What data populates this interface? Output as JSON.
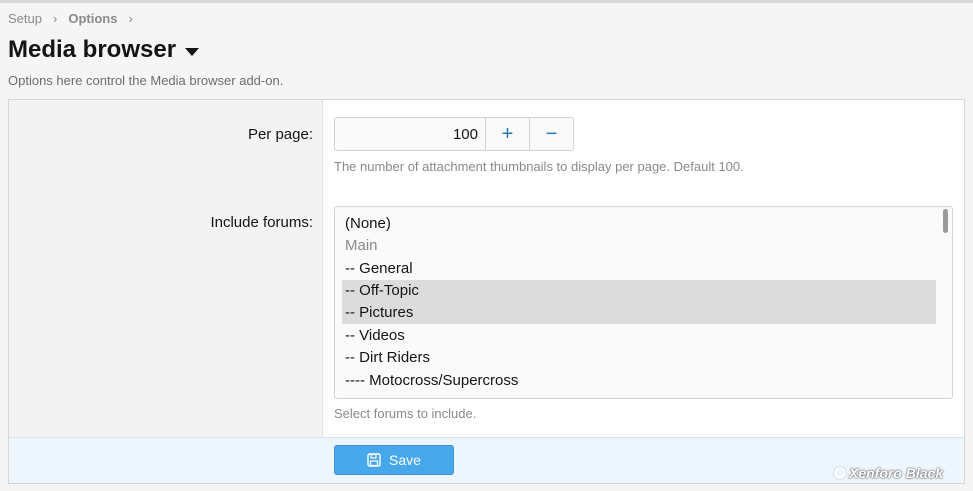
{
  "breadcrumb": {
    "items": [
      "Setup",
      "Options"
    ],
    "sep": "›"
  },
  "page": {
    "title": "Media browser",
    "description": "Options here control the Media browser add-on."
  },
  "per_page": {
    "label": "Per page:",
    "value": "100",
    "plus": "+",
    "minus": "−",
    "hint": "The number of attachment thumbnails to display per page. Default 100."
  },
  "include_forums": {
    "label": "Include forums:",
    "options": [
      {
        "text": "(None)",
        "selected": false
      },
      {
        "text": "Main",
        "selected": false
      },
      {
        "text": "-- General",
        "selected": false
      },
      {
        "text": "-- Off-Topic",
        "selected": true
      },
      {
        "text": "-- Pictures",
        "selected": true
      },
      {
        "text": "-- Videos",
        "selected": false
      },
      {
        "text": "-- Dirt Riders",
        "selected": false
      },
      {
        "text": "---- Motocross/Supercross",
        "selected": false
      }
    ],
    "hint": "Select forums to include."
  },
  "footer": {
    "save_label": "Save"
  },
  "watermark": "Xenforo Black",
  "colors": {
    "accent": "#47a7eb",
    "link": "#2577b1",
    "footer_bg": "#edf6fd"
  },
  "icons": {
    "save": "save-icon",
    "dropdown": "caret-down-icon"
  }
}
